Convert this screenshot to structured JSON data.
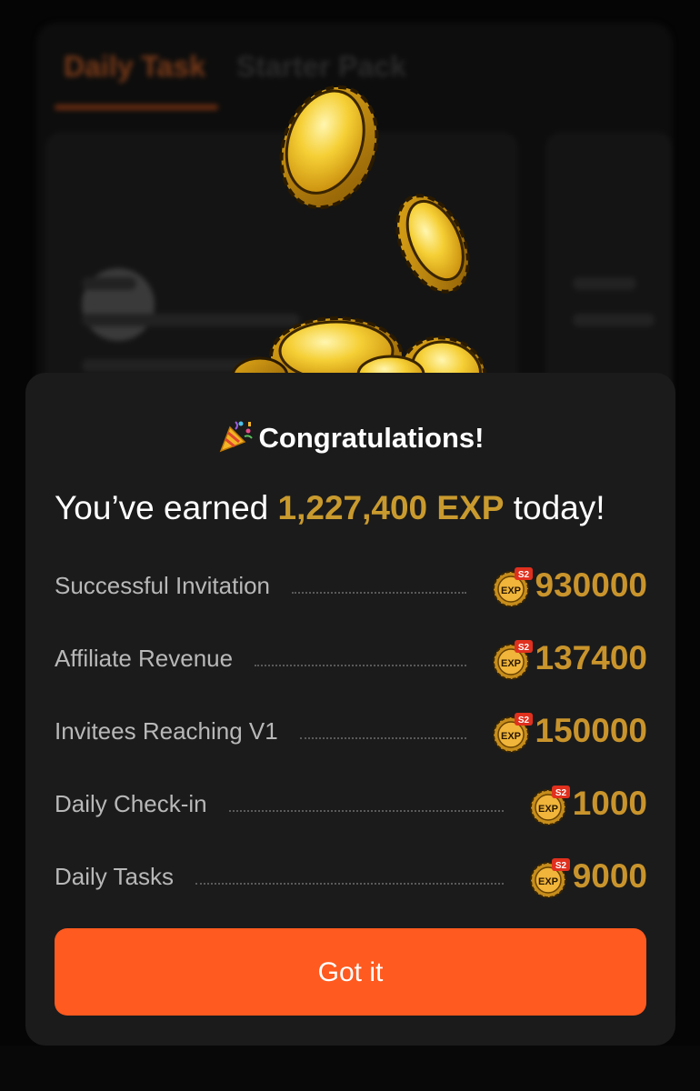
{
  "background": {
    "tab_daily": "Daily Task",
    "tab_starter": "Starter Pack"
  },
  "dialog": {
    "title": "Congratulations!",
    "title_icon": "party-popper-icon",
    "headline_prefix": "You’ve earned ",
    "headline_amount": "1,227,400 EXP",
    "headline_suffix": " today!",
    "badge": {
      "main": "EXP",
      "tag": "S2"
    },
    "rows": [
      {
        "label": "Successful Invitation",
        "value": "930000"
      },
      {
        "label": "Affiliate Revenue",
        "value": "137400"
      },
      {
        "label": "Invitees Reaching V1",
        "value": "150000"
      },
      {
        "label": "Daily Check-in",
        "value": "1000"
      },
      {
        "label": "Daily Tasks",
        "value": "9000"
      }
    ],
    "button_label": "Got it"
  },
  "colors": {
    "accent": "#ff5a1f",
    "gold": "#c9942c",
    "dialog_bg": "#1b1b1b"
  }
}
